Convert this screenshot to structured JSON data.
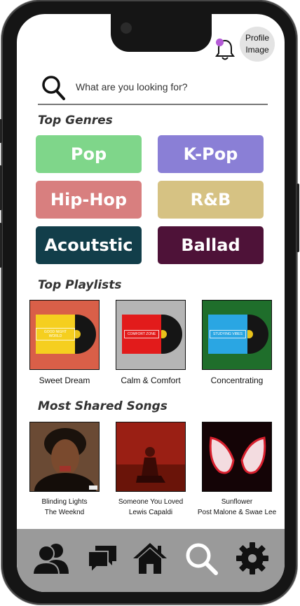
{
  "header": {
    "profile_label": "Profile Image",
    "notification_dot_color": "#b45ad6"
  },
  "search": {
    "placeholder": "What are you looking for?"
  },
  "genres": {
    "title": "Top Genres",
    "items": [
      {
        "label": "Pop",
        "color": "#7fd68a"
      },
      {
        "label": "K-Pop",
        "color": "#8a7fd6"
      },
      {
        "label": "Hip-Hop",
        "color": "#d87f7f"
      },
      {
        "label": "R&B",
        "color": "#d6c283"
      },
      {
        "label": "Acoutstic",
        "color": "#123e4a"
      },
      {
        "label": "Ballad",
        "color": "#4e1238"
      }
    ]
  },
  "playlists": {
    "title": "Top Playlists",
    "items": [
      {
        "label": "Sweet Dream",
        "cover_tag": "GOOD NIGHT WORLD",
        "bg": "#d95f48",
        "sleeve": "#f5cf1f"
      },
      {
        "label": "Calm & Comfort",
        "cover_tag": "COMFORT ZONE",
        "bg": "#b5b5b5",
        "sleeve": "#e21b1b"
      },
      {
        "label": "Concentrating",
        "cover_tag": "STUDYING VIBES",
        "bg": "#1f6e2b",
        "sleeve": "#2aa6e3"
      }
    ]
  },
  "songs": {
    "title": "Most Shared Songs",
    "items": [
      {
        "title": "Blinding Lights",
        "artist": "The Weeknd"
      },
      {
        "title": "Someone You Loved",
        "artist": "Lewis Capaldi"
      },
      {
        "title": "Sunflower",
        "artist": "Post Malone & Swae Lee"
      }
    ]
  },
  "navbar": {
    "items": [
      {
        "icon": "friends-icon"
      },
      {
        "icon": "chat-icon"
      },
      {
        "icon": "home-icon"
      },
      {
        "icon": "search-icon",
        "active": true
      },
      {
        "icon": "settings-icon"
      }
    ]
  }
}
